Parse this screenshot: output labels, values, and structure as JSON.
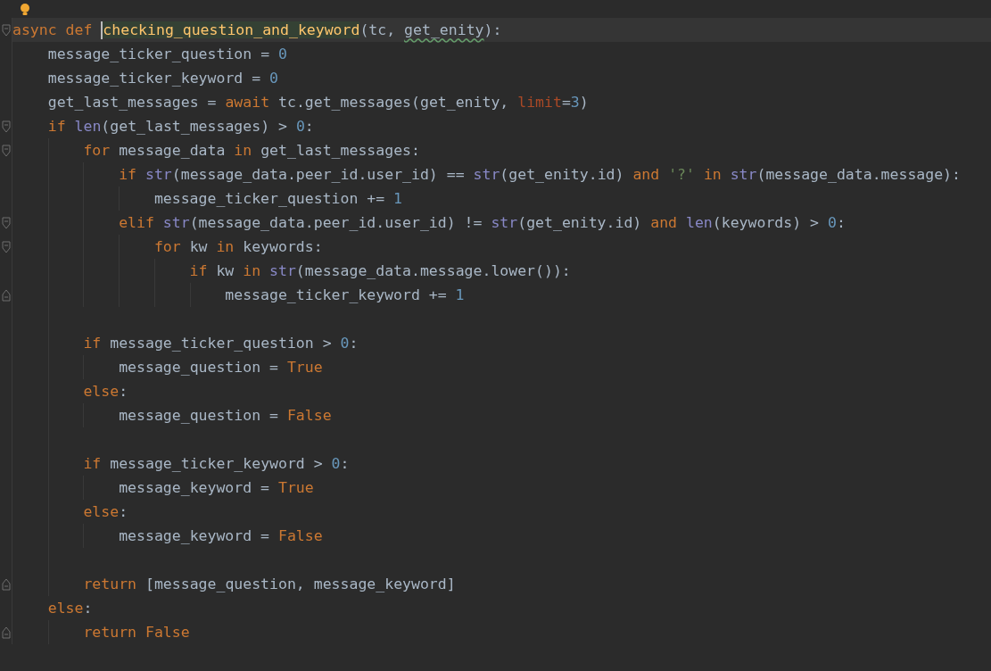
{
  "editor": {
    "lines": [
      {
        "kind": "code",
        "current": true,
        "fold_start": true,
        "fold_end": false,
        "tokens": [
          {
            "kind": "keyword",
            "text": "async def "
          },
          {
            "kind": "function",
            "text": "checking_question_and_keyword",
            "caret": true,
            "highlighted": true
          },
          {
            "kind": "text",
            "text": "(tc, "
          },
          {
            "kind": "text",
            "text": "get_enity",
            "typo": true
          },
          {
            "kind": "text",
            "text": "):"
          }
        ],
        "children": [
          {
            "kind": "code",
            "current": false,
            "fold_start": false,
            "fold_end": false,
            "tokens": [
              {
                "kind": "text",
                "text": "message_ticker_question = "
              },
              {
                "kind": "number",
                "text": "0"
              }
            ]
          },
          {
            "kind": "code",
            "current": false,
            "fold_start": false,
            "fold_end": false,
            "tokens": [
              {
                "kind": "text",
                "text": "message_ticker_keyword = "
              },
              {
                "kind": "number",
                "text": "0"
              }
            ]
          },
          {
            "kind": "code",
            "current": false,
            "fold_start": false,
            "fold_end": false,
            "tokens": [
              {
                "kind": "text",
                "text": "get_last_messages = "
              },
              {
                "kind": "keyword",
                "text": "await"
              },
              {
                "kind": "text",
                "text": " tc.get_messages(get_enity, "
              },
              {
                "kind": "param",
                "text": "limit"
              },
              {
                "kind": "text",
                "text": "="
              },
              {
                "kind": "number",
                "text": "3"
              },
              {
                "kind": "text",
                "text": ")"
              }
            ]
          },
          {
            "kind": "code",
            "current": false,
            "fold_start": true,
            "fold_end": false,
            "tokens": [
              {
                "kind": "keyword",
                "text": "if "
              },
              {
                "kind": "builtin",
                "text": "len"
              },
              {
                "kind": "text",
                "text": "(get_last_messages) > "
              },
              {
                "kind": "number",
                "text": "0"
              },
              {
                "kind": "text",
                "text": ":"
              }
            ],
            "children": [
              {
                "kind": "code",
                "current": false,
                "fold_start": true,
                "fold_end": false,
                "tokens": [
                  {
                    "kind": "keyword",
                    "text": "for "
                  },
                  {
                    "kind": "text",
                    "text": "message_data "
                  },
                  {
                    "kind": "keyword",
                    "text": "in "
                  },
                  {
                    "kind": "text",
                    "text": "get_last_messages:"
                  }
                ],
                "children": [
                  {
                    "kind": "code",
                    "current": false,
                    "fold_start": false,
                    "fold_end": false,
                    "tokens": [
                      {
                        "kind": "keyword",
                        "text": "if "
                      },
                      {
                        "kind": "builtin",
                        "text": "str"
                      },
                      {
                        "kind": "text",
                        "text": "(message_data.peer_id.user_id) == "
                      },
                      {
                        "kind": "builtin",
                        "text": "str"
                      },
                      {
                        "kind": "text",
                        "text": "(get_enity.id) "
                      },
                      {
                        "kind": "keyword",
                        "text": "and "
                      },
                      {
                        "kind": "string",
                        "text": "'?' "
                      },
                      {
                        "kind": "keyword",
                        "text": "in "
                      },
                      {
                        "kind": "builtin",
                        "text": "str"
                      },
                      {
                        "kind": "text",
                        "text": "(message_data.message):"
                      }
                    ],
                    "children": [
                      {
                        "kind": "code",
                        "current": false,
                        "fold_start": false,
                        "fold_end": false,
                        "tokens": [
                          {
                            "kind": "text",
                            "text": "message_ticker_question += "
                          },
                          {
                            "kind": "number",
                            "text": "1"
                          }
                        ]
                      }
                    ]
                  },
                  {
                    "kind": "code",
                    "current": false,
                    "fold_start": true,
                    "fold_end": false,
                    "tokens": [
                      {
                        "kind": "keyword",
                        "text": "elif "
                      },
                      {
                        "kind": "builtin",
                        "text": "str"
                      },
                      {
                        "kind": "text",
                        "text": "(message_data.peer_id.user_id) != "
                      },
                      {
                        "kind": "builtin",
                        "text": "str"
                      },
                      {
                        "kind": "text",
                        "text": "(get_enity.id) "
                      },
                      {
                        "kind": "keyword",
                        "text": "and "
                      },
                      {
                        "kind": "builtin",
                        "text": "len"
                      },
                      {
                        "kind": "text",
                        "text": "(keywords) > "
                      },
                      {
                        "kind": "number",
                        "text": "0"
                      },
                      {
                        "kind": "text",
                        "text": ":"
                      }
                    ],
                    "children": [
                      {
                        "kind": "code",
                        "current": false,
                        "fold_start": true,
                        "fold_end": false,
                        "tokens": [
                          {
                            "kind": "keyword",
                            "text": "for "
                          },
                          {
                            "kind": "text",
                            "text": "kw "
                          },
                          {
                            "kind": "keyword",
                            "text": "in "
                          },
                          {
                            "kind": "text",
                            "text": "keywords:"
                          }
                        ],
                        "children": [
                          {
                            "kind": "code",
                            "current": false,
                            "fold_start": false,
                            "fold_end": false,
                            "tokens": [
                              {
                                "kind": "keyword",
                                "text": "if "
                              },
                              {
                                "kind": "text",
                                "text": "kw "
                              },
                              {
                                "kind": "keyword",
                                "text": "in "
                              },
                              {
                                "kind": "builtin",
                                "text": "str"
                              },
                              {
                                "kind": "text",
                                "text": "(message_data.message.lower()):"
                              }
                            ],
                            "children": [
                              {
                                "kind": "code",
                                "current": false,
                                "fold_start": false,
                                "fold_end": true,
                                "tokens": [
                                  {
                                    "kind": "text",
                                    "text": "message_ticker_keyword += "
                                  },
                                  {
                                    "kind": "number",
                                    "text": "1"
                                  }
                                ]
                              }
                            ]
                          }
                        ]
                      }
                    ]
                  }
                ]
              },
              {
                "kind": "blank",
                "current": false,
                "fold_start": false,
                "fold_end": false
              },
              {
                "kind": "code",
                "current": false,
                "fold_start": false,
                "fold_end": false,
                "tokens": [
                  {
                    "kind": "keyword",
                    "text": "if "
                  },
                  {
                    "kind": "text",
                    "text": "message_ticker_question > "
                  },
                  {
                    "kind": "number",
                    "text": "0"
                  },
                  {
                    "kind": "text",
                    "text": ":"
                  }
                ],
                "children": [
                  {
                    "kind": "code",
                    "current": false,
                    "fold_start": false,
                    "fold_end": false,
                    "tokens": [
                      {
                        "kind": "text",
                        "text": "message_question = "
                      },
                      {
                        "kind": "keyword",
                        "text": "True"
                      }
                    ]
                  }
                ]
              },
              {
                "kind": "code",
                "current": false,
                "fold_start": false,
                "fold_end": false,
                "tokens": [
                  {
                    "kind": "keyword",
                    "text": "else"
                  },
                  {
                    "kind": "text",
                    "text": ":"
                  }
                ],
                "children": [
                  {
                    "kind": "code",
                    "current": false,
                    "fold_start": false,
                    "fold_end": false,
                    "tokens": [
                      {
                        "kind": "text",
                        "text": "message_question = "
                      },
                      {
                        "kind": "keyword",
                        "text": "False"
                      }
                    ]
                  }
                ]
              },
              {
                "kind": "blank",
                "current": false,
                "fold_start": false,
                "fold_end": false
              },
              {
                "kind": "code",
                "current": false,
                "fold_start": false,
                "fold_end": false,
                "tokens": [
                  {
                    "kind": "keyword",
                    "text": "if "
                  },
                  {
                    "kind": "text",
                    "text": "message_ticker_keyword > "
                  },
                  {
                    "kind": "number",
                    "text": "0"
                  },
                  {
                    "kind": "text",
                    "text": ":"
                  }
                ],
                "children": [
                  {
                    "kind": "code",
                    "current": false,
                    "fold_start": false,
                    "fold_end": false,
                    "tokens": [
                      {
                        "kind": "text",
                        "text": "message_keyword = "
                      },
                      {
                        "kind": "keyword",
                        "text": "True"
                      }
                    ]
                  }
                ]
              },
              {
                "kind": "code",
                "current": false,
                "fold_start": false,
                "fold_end": false,
                "tokens": [
                  {
                    "kind": "keyword",
                    "text": "else"
                  },
                  {
                    "kind": "text",
                    "text": ":"
                  }
                ],
                "children": [
                  {
                    "kind": "code",
                    "current": false,
                    "fold_start": false,
                    "fold_end": false,
                    "tokens": [
                      {
                        "kind": "text",
                        "text": "message_keyword = "
                      },
                      {
                        "kind": "keyword",
                        "text": "False"
                      }
                    ]
                  }
                ]
              },
              {
                "kind": "blank",
                "current": false,
                "fold_start": false,
                "fold_end": false
              },
              {
                "kind": "code",
                "current": false,
                "fold_start": false,
                "fold_end": true,
                "tokens": [
                  {
                    "kind": "keyword",
                    "text": "return "
                  },
                  {
                    "kind": "text",
                    "text": "[message_question, message_keyword]"
                  }
                ]
              }
            ]
          },
          {
            "kind": "code",
            "current": false,
            "fold_start": false,
            "fold_end": false,
            "tokens": [
              {
                "kind": "keyword",
                "text": "else"
              },
              {
                "kind": "text",
                "text": ":"
              }
            ],
            "children": [
              {
                "kind": "code",
                "current": false,
                "fold_start": false,
                "fold_end": true,
                "tokens": [
                  {
                    "kind": "keyword",
                    "text": "return "
                  },
                  {
                    "kind": "keyword",
                    "text": "False"
                  }
                ]
              }
            ]
          }
        ]
      }
    ]
  }
}
